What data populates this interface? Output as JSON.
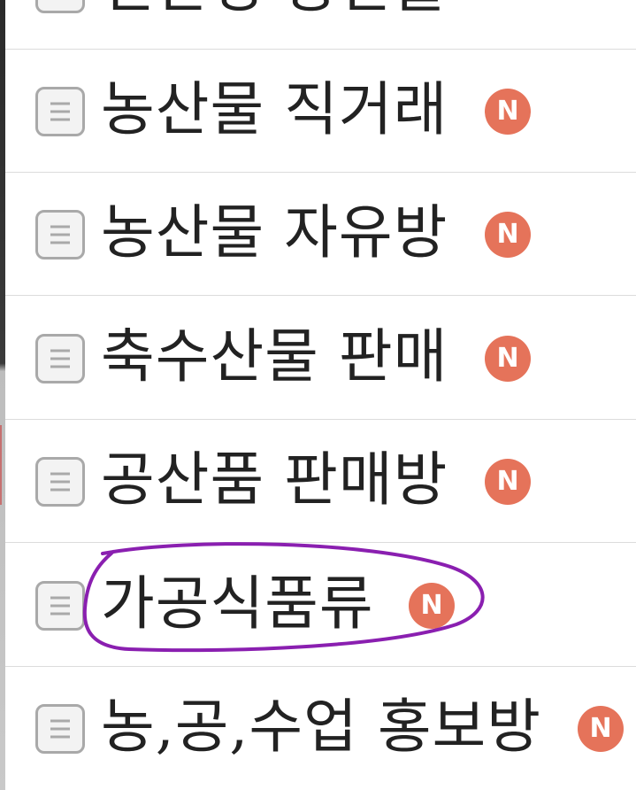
{
  "colors": {
    "badge": "#e5735a",
    "annotation": "#8a1fb0",
    "divider": "#dcdcdc",
    "text": "#222222"
  },
  "board_icon": "document-lines-icon",
  "new_badge_label": "N",
  "boards": [
    {
      "label": "친환경 농산물",
      "new": false
    },
    {
      "label": "농산물 직거래",
      "new": true
    },
    {
      "label": "농산물 자유방",
      "new": true
    },
    {
      "label": "축수산물 판매",
      "new": true
    },
    {
      "label": "공산품 판매방",
      "new": true
    },
    {
      "label": "가공식품류",
      "new": true,
      "circled": true
    },
    {
      "label": "농,공,수업 홍보방",
      "new": true
    }
  ]
}
